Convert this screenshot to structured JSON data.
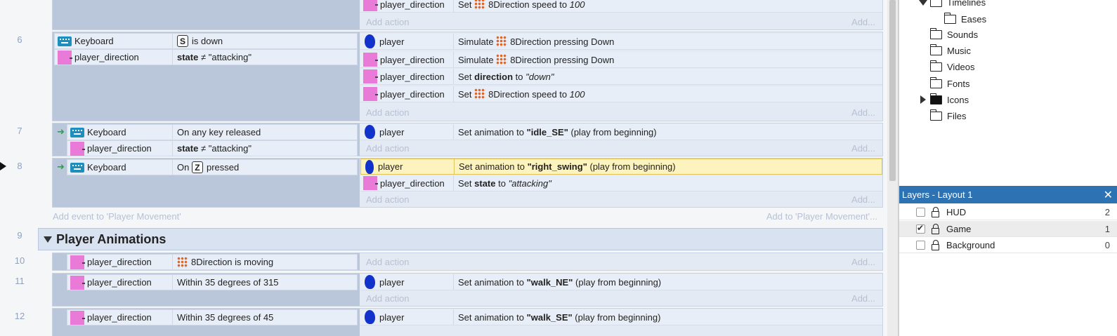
{
  "sheet": {
    "line_numbers": {
      "e6": "6",
      "e7": "7",
      "e8": "8",
      "g9": "9",
      "e10": "10",
      "e11": "11",
      "e12": "12"
    },
    "add_action": "Add action",
    "add_action_right": "Add...",
    "add_event": "Add event to 'Player Movement'",
    "add_to_group": "Add to 'Player Movement'...",
    "top_partial": {
      "action_obj": "player_direction",
      "action_text": {
        "pre": "Set",
        "mid": "8Direction speed to",
        "val": "100"
      }
    },
    "event6": {
      "conditions": [
        {
          "obj": "Keyboard",
          "key": "S",
          "text": "is down"
        },
        {
          "obj": "player_direction",
          "bold": "state",
          "text": "≠ \"attacking\""
        }
      ],
      "actions": [
        {
          "obj": "player",
          "pre": "Simulate",
          "post": "8Direction pressing Down"
        },
        {
          "obj": "player_direction",
          "pre": "Simulate",
          "post": "8Direction pressing Down"
        },
        {
          "obj": "player_direction",
          "pre": "Set",
          "bold": "direction",
          "mid": "to",
          "ital": "\"down\""
        },
        {
          "obj": "player_direction",
          "pre": "Set",
          "post": "8Direction speed to",
          "ital": "100"
        }
      ]
    },
    "event7": {
      "conditions": [
        {
          "obj": "Keyboard",
          "text": "On any key released"
        },
        {
          "obj": "player_direction",
          "bold": "state",
          "text": "≠ \"attacking\""
        }
      ],
      "actions": [
        {
          "obj": "player",
          "pre": "Set animation to",
          "bold": "\"idle_SE\"",
          "post": "(play from beginning)"
        }
      ]
    },
    "event8": {
      "conditions": [
        {
          "obj": "Keyboard",
          "pre": "On",
          "key": "Z",
          "text": "pressed"
        }
      ],
      "actions": [
        {
          "obj": "player",
          "pre": "Set animation to",
          "bold": "\"right_swing\"",
          "post": "(play from beginning)"
        },
        {
          "obj": "player_direction",
          "pre": "Set",
          "bold": "state",
          "mid": "to",
          "ital": "\"attacking\""
        }
      ]
    },
    "group": {
      "title": "Player Animations"
    },
    "event10": {
      "conditions": [
        {
          "obj": "player_direction",
          "text": "8Direction is moving"
        }
      ]
    },
    "event11": {
      "conditions": [
        {
          "obj": "player_direction",
          "text": "Within 35 degrees of 315"
        }
      ],
      "actions": [
        {
          "obj": "player",
          "pre": "Set animation to",
          "bold": "\"walk_NE\"",
          "post": "(play from beginning)"
        }
      ]
    },
    "event12": {
      "conditions": [
        {
          "obj": "player_direction",
          "text": "Within 35 degrees of 45"
        }
      ],
      "actions": [
        {
          "obj": "player",
          "pre": "Set animation to",
          "bold": "\"walk_SE\"",
          "post": "(play from beginning)"
        }
      ]
    }
  },
  "project_tree": {
    "items": [
      {
        "label": "Timelines"
      },
      {
        "label": "Eases"
      },
      {
        "label": "Sounds"
      },
      {
        "label": "Music"
      },
      {
        "label": "Videos"
      },
      {
        "label": "Fonts"
      },
      {
        "label": "Icons"
      },
      {
        "label": "Files"
      }
    ]
  },
  "layers_panel": {
    "title": "Layers - Layout 1",
    "close": "✕",
    "layers": [
      {
        "name": "HUD",
        "count": "2",
        "visible": false
      },
      {
        "name": "Game",
        "count": "1",
        "visible": true
      },
      {
        "name": "Background",
        "count": "0",
        "visible": false
      }
    ]
  },
  "colors": {
    "accent_header": "#2d73b3",
    "highlight": "#fdf3bf",
    "family_icon": "#ea7ad8",
    "sprite_icon": "#1133cc",
    "keyboard_icon": "#1d8fbf"
  }
}
